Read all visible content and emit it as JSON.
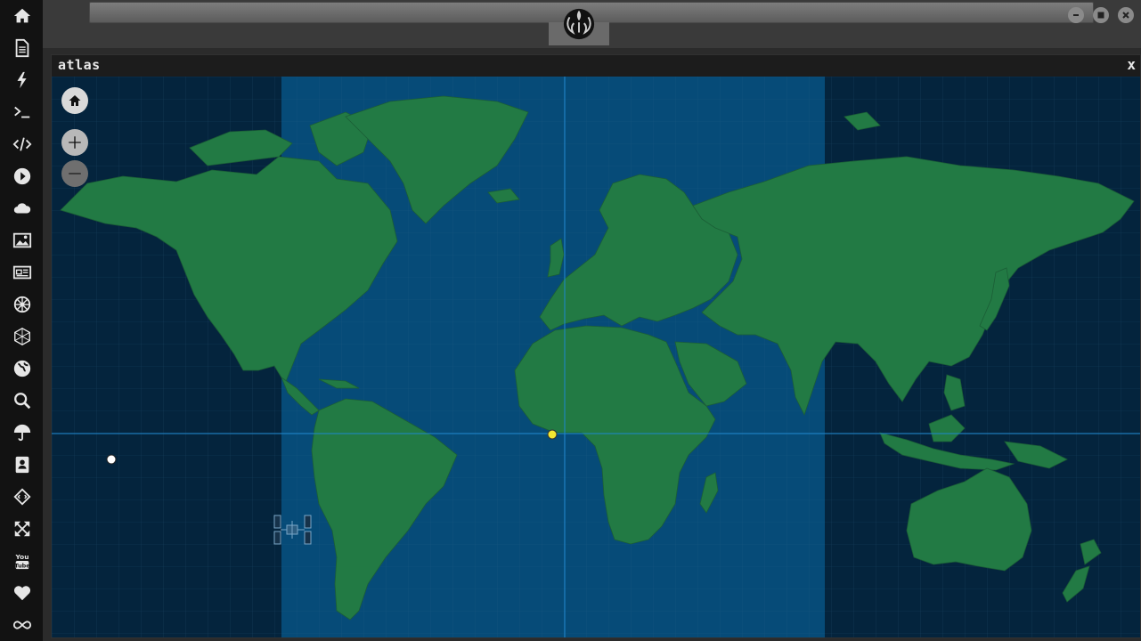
{
  "window": {
    "title": "atlas",
    "close_label": "x"
  },
  "dock": {
    "items": [
      {
        "name": "home-icon"
      },
      {
        "name": "document-icon"
      },
      {
        "name": "lightning-icon"
      },
      {
        "name": "terminal-icon"
      },
      {
        "name": "code-icon"
      },
      {
        "name": "play-icon"
      },
      {
        "name": "cloud-icon"
      },
      {
        "name": "image-icon"
      },
      {
        "name": "newspaper-icon"
      },
      {
        "name": "empire-icon"
      },
      {
        "name": "hexagon-net-icon"
      },
      {
        "name": "globe-icon"
      },
      {
        "name": "search-icon"
      },
      {
        "name": "umbrella-icon"
      },
      {
        "name": "contacts-icon"
      },
      {
        "name": "diamond-code-icon"
      },
      {
        "name": "expand-icon"
      },
      {
        "name": "youtube-icon"
      },
      {
        "name": "heart-icon"
      },
      {
        "name": "infinity-icon"
      }
    ]
  },
  "map": {
    "controls": [
      "home",
      "zoom-in",
      "zoom-out"
    ],
    "markers": [
      {
        "name": "sun-marker",
        "color": "#f4e832"
      },
      {
        "name": "moon-marker",
        "color": "#ffffff"
      },
      {
        "name": "iss-marker"
      }
    ],
    "colors": {
      "ocean": "#04243d",
      "daylight": "#064b78",
      "land": "#227a44",
      "line": "#1e88d0"
    }
  }
}
